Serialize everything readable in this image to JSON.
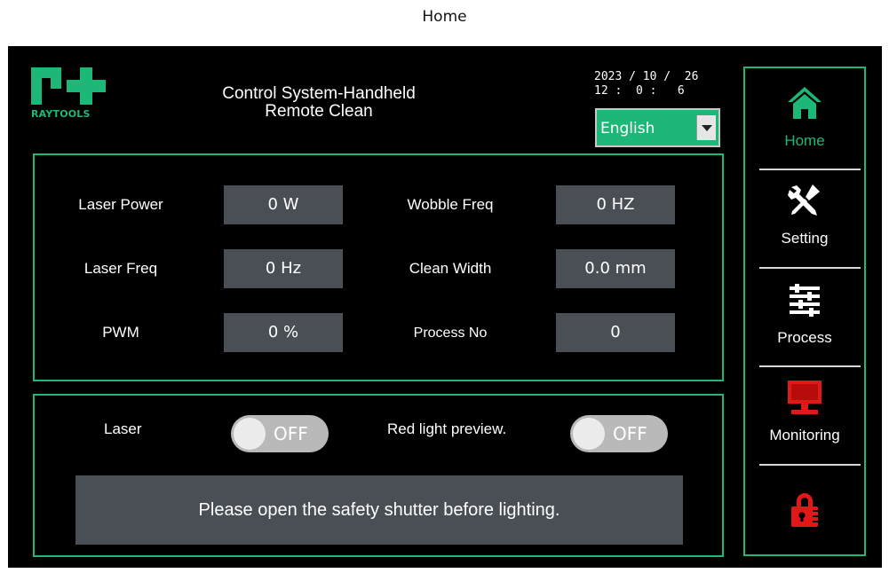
{
  "caption": "Home",
  "header": {
    "brand": "RAYTOOLS",
    "title_line1": "Control System-Handheld",
    "title_line2": "Remote Clean",
    "date": "2023 / 10 /  26",
    "time": "12 :  0 :   6",
    "language": "English"
  },
  "params": {
    "laser_power": {
      "label": "Laser Power",
      "value": "0 W"
    },
    "laser_freq": {
      "label": "Laser Freq",
      "value": "0 Hz"
    },
    "pwm": {
      "label": "PWM",
      "value": "0 %"
    },
    "wobble_freq": {
      "label": "Wobble Freq",
      "value": "0 HZ"
    },
    "clean_width": {
      "label": "Clean Width",
      "value": "0.0 mm"
    },
    "process_no": {
      "label": "Process No",
      "value": "0"
    }
  },
  "controls": {
    "laser": {
      "label": "Laser",
      "state": "OFF"
    },
    "red_light": {
      "label": "Red light preview.",
      "state": "OFF"
    },
    "notice": "Please open the safety shutter before lighting."
  },
  "nav": {
    "home": {
      "label": "Home",
      "icon": "home-icon"
    },
    "setting": {
      "label": "Setting",
      "icon": "tools-icon"
    },
    "process": {
      "label": "Process",
      "icon": "sliders-icon"
    },
    "monitoring": {
      "label": "Monitoring",
      "icon": "monitor-icon"
    },
    "lock": {
      "icon": "lock-icon"
    }
  },
  "colors": {
    "accent": "#1db877",
    "field_bg": "#4a4f56",
    "monitor_red": "#e01818"
  }
}
